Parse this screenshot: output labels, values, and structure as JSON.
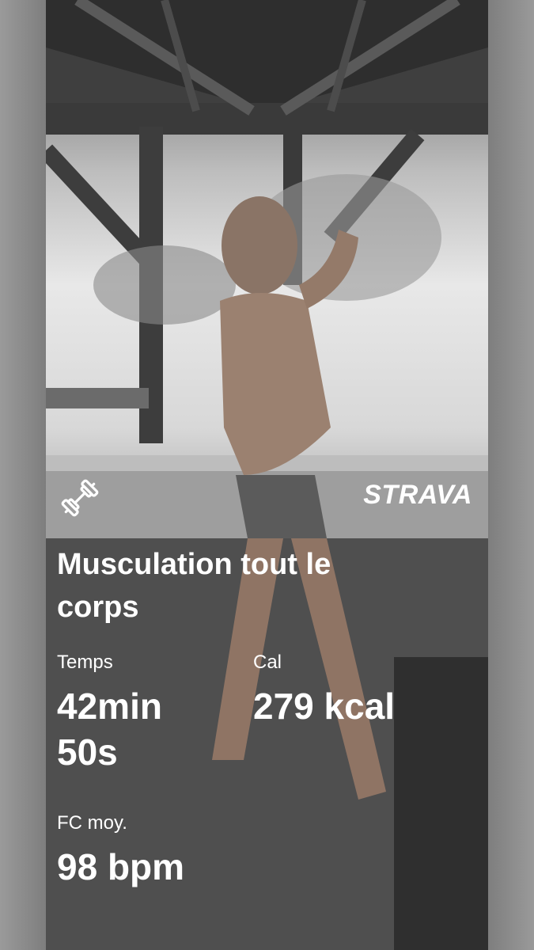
{
  "activity": {
    "sport_icon": "dumbbell-icon",
    "brand": "STRAVA",
    "title": "Musculation tout le corps"
  },
  "stats": {
    "time": {
      "label": "Temps",
      "value": "42min 50s"
    },
    "calories": {
      "label": "Cal",
      "value": "279 kcal"
    },
    "heart_rate": {
      "label": "FC moy.",
      "value": "98 bpm"
    }
  },
  "colors": {
    "overlay_text": "#ffffff",
    "side_strip": "#8d8d8d"
  }
}
